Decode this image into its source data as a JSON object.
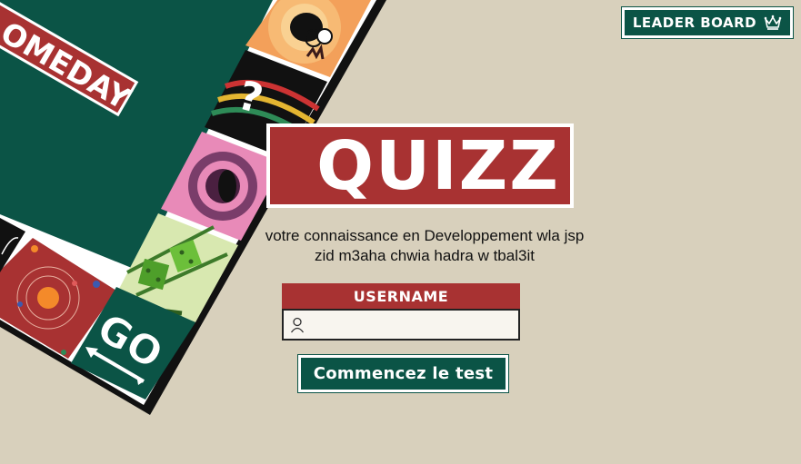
{
  "header": {
    "leaderboard_label": "LEADER BOARD",
    "leaderboard_icon": "crown-icon"
  },
  "board": {
    "banner_text": "OMEDAY",
    "go_text": "GO",
    "colors": {
      "green": "#0b5446",
      "red": "#a83232",
      "black": "#111111",
      "white": "#ffffff"
    }
  },
  "main": {
    "title": "QUIZZ",
    "subtitle_line1": "votre connaissance en Developpement wla jsp",
    "subtitle_line2": "zid m3aha chwia hadra w tbal3it",
    "username_label": "USERNAME",
    "username_value": "",
    "username_icon": "user-icon",
    "start_label": "Commencez le test"
  },
  "colors": {
    "background": "#d8d0bc",
    "accent_red": "#a83232",
    "accent_green": "#0b5446"
  }
}
